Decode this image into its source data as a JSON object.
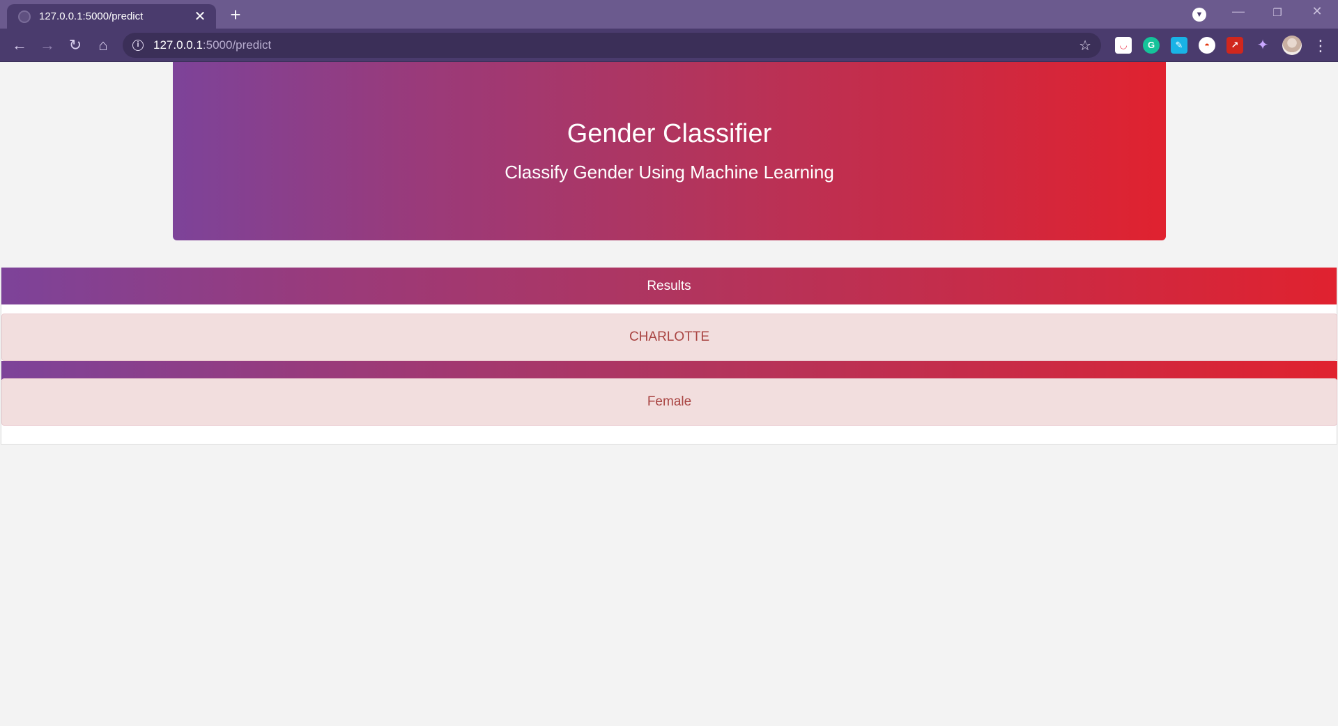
{
  "browser": {
    "tab_title": "127.0.0.1:5000/predict",
    "url_host": "127.0.0.1",
    "url_path": ":5000/predict"
  },
  "header": {
    "title": "Gender Classifier",
    "subtitle": "Classify Gender Using Machine Learning"
  },
  "results": {
    "heading": "Results",
    "name": "CHARLOTTE",
    "prediction": "Female"
  },
  "colors": {
    "gradient_start": "#7d4399",
    "gradient_end": "#e0222f",
    "alert_bg": "#f2dede",
    "alert_text": "#a94442"
  }
}
